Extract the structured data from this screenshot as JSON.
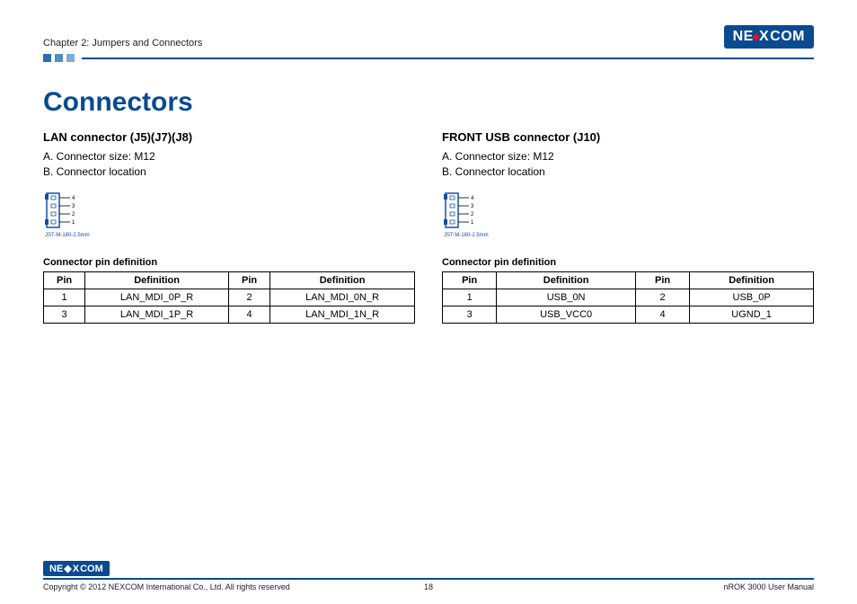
{
  "header": {
    "chapter": "Chapter 2: Jumpers and Connectors",
    "logo_text_1": "NE",
    "logo_text_x": "X",
    "logo_text_2": "COM"
  },
  "title": "Connectors",
  "left": {
    "heading": "LAN connector (J5)(J7)(J8)",
    "lineA": "A. Connector size: M12",
    "lineB": "B. Connector location",
    "diag_label": "JST-M-180-2.5mm",
    "table_caption": "Connector pin definition",
    "th_pin": "Pin",
    "th_def": "Definition",
    "rows": [
      {
        "p1": "1",
        "d1": "LAN_MDI_0P_R",
        "p2": "2",
        "d2": "LAN_MDI_0N_R"
      },
      {
        "p1": "3",
        "d1": "LAN_MDI_1P_R",
        "p2": "4",
        "d2": "LAN_MDI_1N_R"
      }
    ]
  },
  "right": {
    "heading": "FRONT USB connector (J10)",
    "lineA": "A. Connector size: M12",
    "lineB": "B. Connector location",
    "diag_label": "JST-M-180-2.5mm",
    "table_caption": "Connector pin definition",
    "th_pin": "Pin",
    "th_def": "Definition",
    "rows": [
      {
        "p1": "1",
        "d1": "USB_0N",
        "p2": "2",
        "d2": "USB_0P"
      },
      {
        "p1": "3",
        "d1": "USB_VCC0",
        "p2": "4",
        "d2": "UGND_1"
      }
    ]
  },
  "footer": {
    "copyright": "Copyright © 2012 NEXCOM International Co., Ltd. All rights reserved",
    "page": "18",
    "manual": "nROK 3000 User Manual"
  },
  "diag_pins": [
    "4",
    "3",
    "2",
    "1"
  ]
}
